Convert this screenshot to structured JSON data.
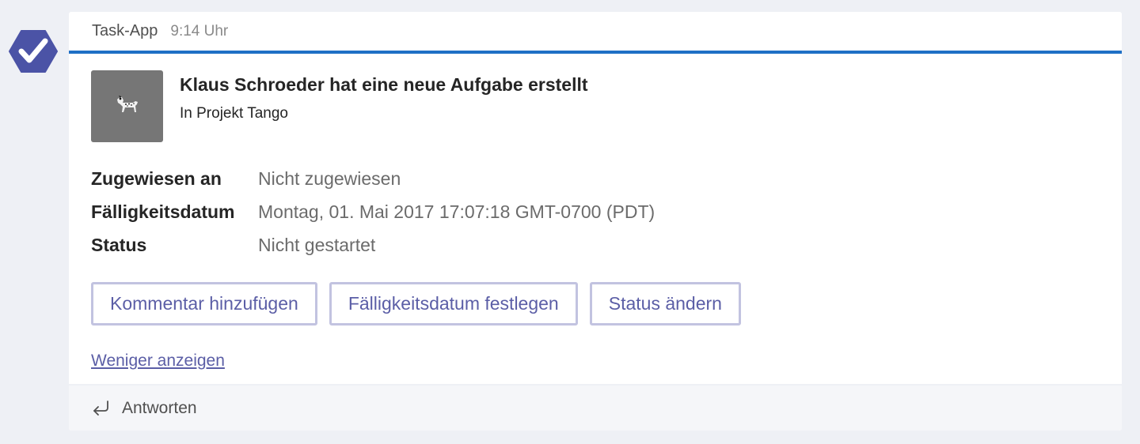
{
  "app": {
    "icon": "checkmark-hexagon-icon",
    "icon_color": "#4b53a6"
  },
  "header": {
    "sender": "Task-App",
    "time": "9:14 Uhr",
    "accent_color": "#1f6fc5"
  },
  "hero": {
    "image_icon": "dalmatian-dog-image",
    "title": "Klaus Schroeder hat eine neue Aufgabe erstellt",
    "subtitle": "In Projekt Tango"
  },
  "facts": [
    {
      "label": "Zugewiesen an",
      "value": "Nicht zugewiesen"
    },
    {
      "label": "Fälligkeitsdatum",
      "value": "Montag, 01. Mai 2017 17:07:18 GMT-0700 (PDT)"
    },
    {
      "label": "Status",
      "value": "Nicht gestartet"
    }
  ],
  "actions": [
    {
      "label": "Kommentar hinzufügen"
    },
    {
      "label": "Fälligkeitsdatum festlegen"
    },
    {
      "label": "Status ändern"
    }
  ],
  "show_less": "Weniger anzeigen",
  "footer": {
    "reply_icon": "reply-arrow-icon",
    "reply_label": "Antworten"
  }
}
